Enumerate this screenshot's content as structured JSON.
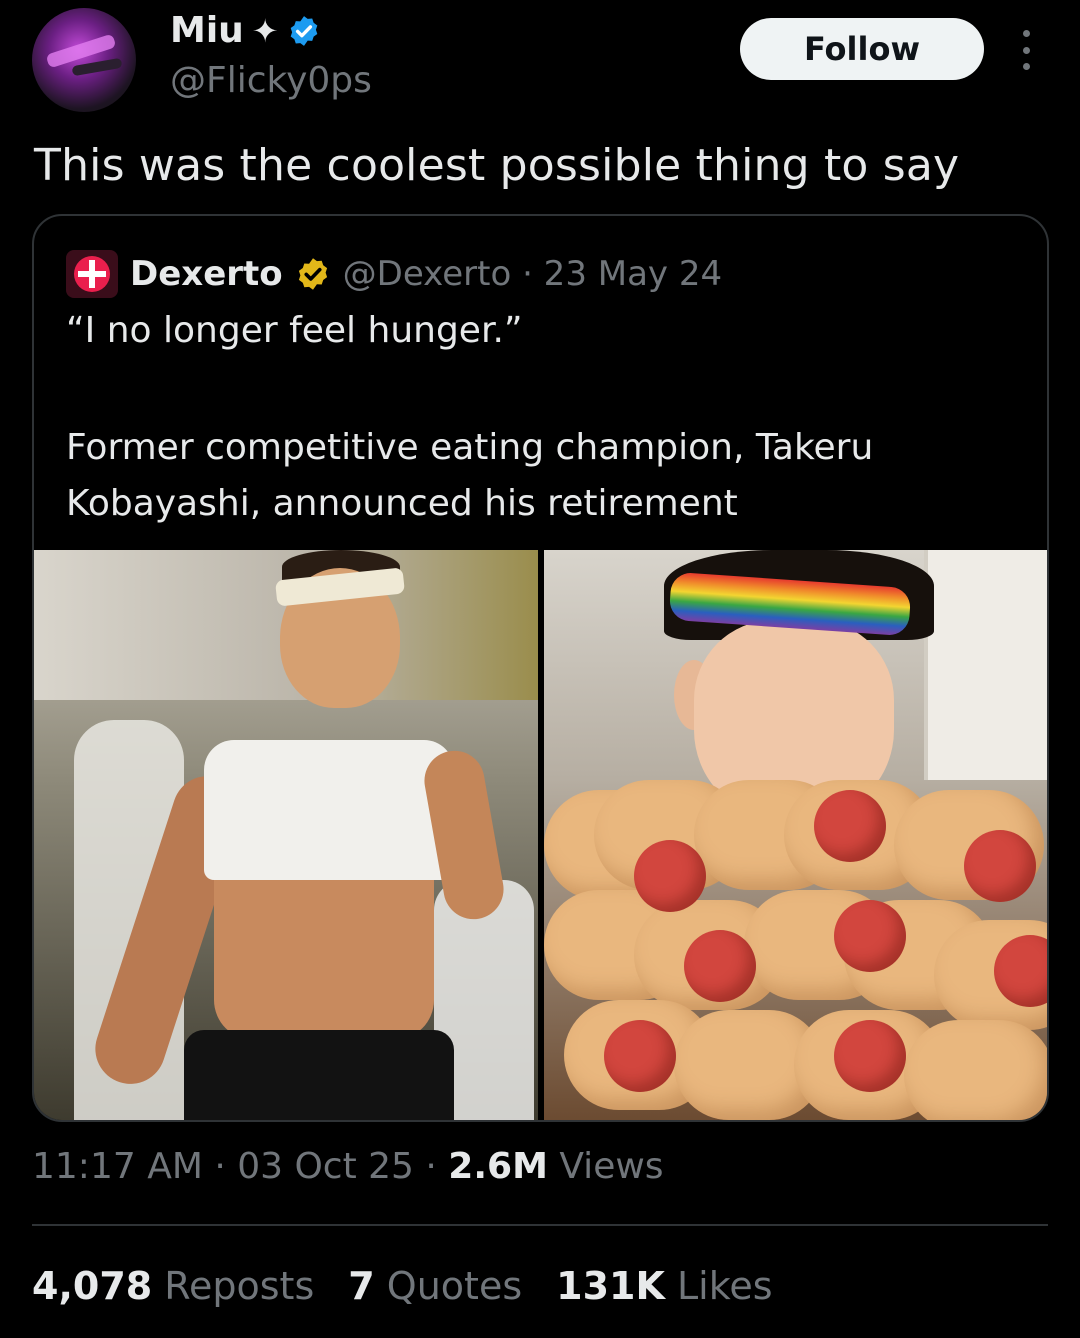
{
  "author": {
    "name": "Miu",
    "name_suffix": "✦",
    "handle": "@Flicky0ps",
    "verified_color": "#1d9bf0"
  },
  "follow_label": "Follow",
  "tweet_text": "This was the coolest possible thing to say",
  "quoted": {
    "name": "Dexerto",
    "meta": "@Dexerto · 23 May 24",
    "badge_color": "#e2b719",
    "line1": "“I no longer feel hunger.”",
    "line2": "Former competitive eating champion, Takeru Kobayashi, announced his retirement"
  },
  "timestamp": {
    "time_date": "11:17 AM · 03 Oct 25 · ",
    "views_count": "2.6M",
    "views_label": " Views"
  },
  "stats": {
    "reposts_count": "4,078",
    "reposts_label": "Reposts",
    "quotes_count": "7",
    "quotes_label": "Quotes",
    "likes_count": "131K",
    "likes_label": "Likes"
  }
}
